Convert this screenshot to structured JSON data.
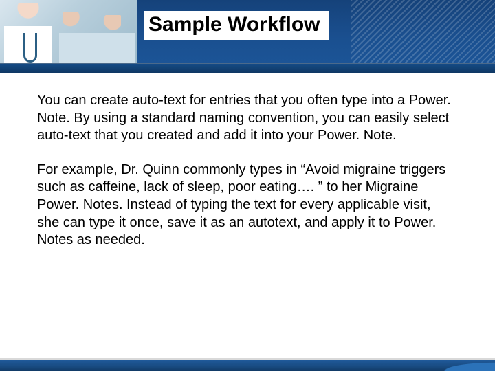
{
  "title": "Sample Workflow",
  "paragraphs": [
    "You can create auto-text for entries that you often type into a Power. Note. By using a standard naming convention, you can easily select auto-text that you created and add it into your Power. Note.",
    "For example, Dr. Quinn commonly types in “Avoid migraine triggers such as caffeine, lack of sleep, poor eating…. ” to her Migraine Power. Notes. Instead of typing the text for every applicable visit, she can type it once, save it as an autotext, and apply it to Power. Notes as needed."
  ]
}
